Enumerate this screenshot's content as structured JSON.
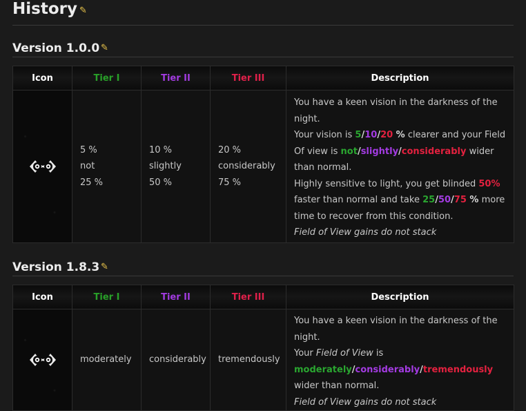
{
  "history": {
    "title": "History"
  },
  "sections": [
    {
      "title": "Version 1.0.0",
      "headers": {
        "icon": "Icon",
        "tier1": "Tier I",
        "tier2": "Tier II",
        "tier3": "Tier III",
        "description": "Description"
      },
      "tier1": {
        "line1": "5 %",
        "line2": "not",
        "line3": "25 %"
      },
      "tier2": {
        "line1": "10 %",
        "line2": "slightly",
        "line3": "50 %"
      },
      "tier3": {
        "line1": "20 %",
        "line2": "considerably",
        "line3": "75 %"
      },
      "desc": {
        "p1": "You have a keen vision in the darkness of the night.",
        "p2_a": "Your vision is ",
        "v1": "5",
        "s1": "/",
        "v2": "10",
        "s2": "/",
        "v3": "20",
        "unit1": " %",
        "p2_b": " clearer and your Field Of view is ",
        "w1": "not",
        "s3": "/",
        "w2": "slightly",
        "s4": "/",
        "w3": "considerably",
        "p2_c": " wider than normal.",
        "p3_a": "Highly sensitive to light, you get blinded ",
        "blind": "50%",
        "p3_b": " faster than normal and take ",
        "t1": "25",
        "s5": "/",
        "t2": "50",
        "s6": "/",
        "t3": "75",
        "unit2": " %",
        "p3_c": " more time to recover from this condition.",
        "note": "Field of View gains do not stack"
      }
    },
    {
      "title": "Version 1.8.3",
      "headers": {
        "icon": "Icon",
        "tier1": "Tier I",
        "tier2": "Tier II",
        "tier3": "Tier III",
        "description": "Description"
      },
      "tier1": "moderately",
      "tier2": "considerably",
      "tier3": "tremendously",
      "desc": {
        "p1": "You have a keen vision in the darkness of the night.",
        "p2_a": "Your ",
        "fov": "Field of View",
        "p2_b": " is ",
        "w1": "moderately",
        "s1": "/",
        "w2": "considerably",
        "s2": "/",
        "w3": "tremendously",
        "p2_c": " wider than normal.",
        "note": "Field of View gains do not stack"
      }
    }
  ],
  "icons": {
    "edit": "pencil-icon",
    "perk": "owl-eyes-icon"
  },
  "colors": {
    "tier1": "#28a028",
    "tier2": "#a23be0",
    "tier3": "#e0204a",
    "edit": "#e8c34a"
  }
}
